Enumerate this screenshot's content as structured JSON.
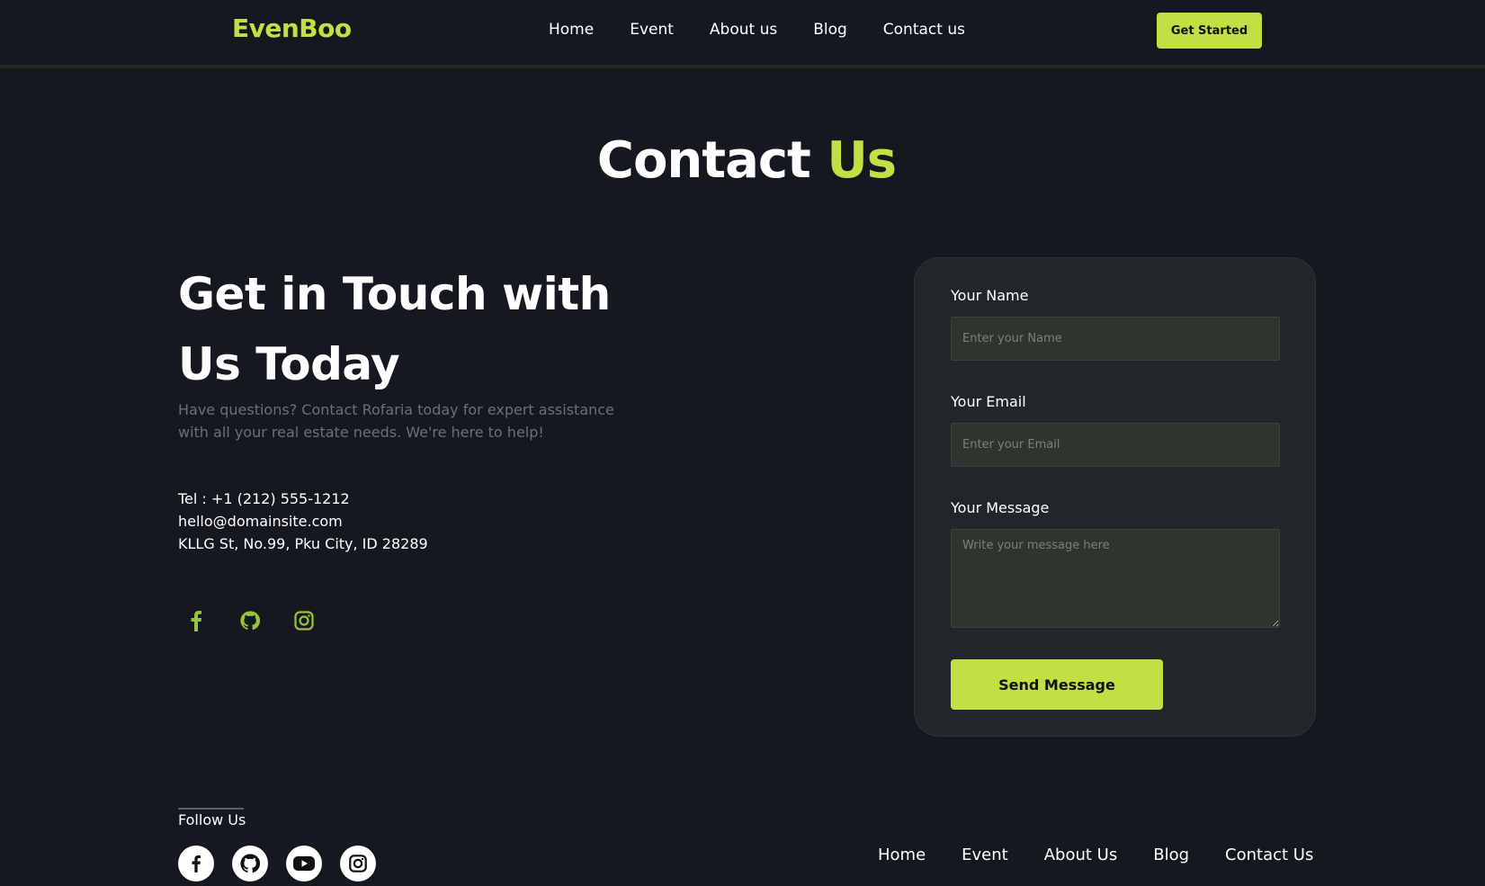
{
  "navbar": {
    "brand": "EvenBoo",
    "links": [
      "Home",
      "Event",
      "About us",
      "Blog",
      "Contact us"
    ],
    "cta": "Get Started"
  },
  "section_title": {
    "main": "Contact",
    "accent": "Us"
  },
  "info": {
    "headline_line1": "Get in Touch with",
    "headline_line2": "Us Today",
    "lead_line1": "Have questions? Contact Rofaria today for expert assistance",
    "lead_line2": "with all your real estate needs. We're here to help!",
    "phone": "Tel : +1 (212) 555-1212",
    "email": "hello@domainsite.com",
    "address": "KLLG St, No.99, Pku City, ID 28289",
    "social_icons": [
      "facebook-icon",
      "github-icon",
      "instagram-icon"
    ]
  },
  "form": {
    "name_label": "Your Name",
    "name_placeholder": "Enter your Name",
    "email_label": "Your Email",
    "email_placeholder": "Enter your Email",
    "message_label": "Your Message",
    "message_placeholder": "Write your message here",
    "submit": "Send Message"
  },
  "footer": {
    "follow_label": "Follow Us",
    "social_icons": [
      "facebook-icon",
      "github-icon",
      "youtube-icon",
      "instagram-icon"
    ],
    "links": [
      "Home",
      "Event",
      "About Us",
      "Blog",
      "Contact Us"
    ]
  },
  "colors": {
    "background": "#15191f",
    "accent": "#c2e043",
    "card": "#22262b",
    "input": "#2f342f",
    "muted_text": "#6b7078"
  }
}
